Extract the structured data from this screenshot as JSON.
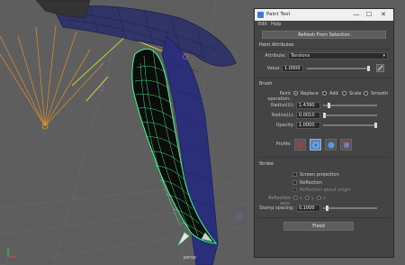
{
  "window": {
    "title": "Paint Tool",
    "controls": {
      "minimize": "—",
      "maximize": "☐",
      "close": "✕"
    }
  },
  "menu": {
    "items": [
      "Edit",
      "Help"
    ]
  },
  "toolbar": {
    "refresh_label": "Refresh From Selection"
  },
  "paint_attributes": {
    "heading": "Paint Attributes",
    "attribute_label": "Attribute:",
    "attribute_value": "Tensions",
    "value_label": "Value:",
    "value": "1.0000",
    "value_slider_fraction": 1.0
  },
  "brush": {
    "heading": "Brush",
    "paint_operation_label": "Paint operation:",
    "operations": [
      "Replace",
      "Add",
      "Scale",
      "Smooth"
    ],
    "selected_operation": "Replace",
    "radius_u_label": "Radius(U):",
    "radius_u": "1.4390",
    "radius_u_fraction": 0.08,
    "radius_l_label": "Radius(L):",
    "radius_l": "0.0010",
    "radius_l_fraction": 0.0,
    "opacity_label": "Opacity:",
    "opacity": "1.0000",
    "opacity_fraction": 1.0,
    "profile_label": "Profile:",
    "profiles": [
      "gaussian-icon",
      "soft-icon",
      "solid-icon",
      "square-icon"
    ],
    "selected_profile": "soft-icon"
  },
  "stroke": {
    "heading": "Stroke",
    "screen_projection": "Screen projection",
    "reflection": "Reflection",
    "reflection_about_origin": "Reflection about origin",
    "reflection_axis_label": "Reflection axis:",
    "axes": [
      "x",
      "y",
      "z"
    ],
    "stamp_spacing_label": "Stamp spacing:",
    "stamp_spacing": "0.1000",
    "stamp_spacing_fraction": 0.05
  },
  "actions": {
    "flood_label": "Flood"
  },
  "viewport": {
    "camera_label": "persp"
  },
  "colors": {
    "wire_highlight": "#3dff8c",
    "wire_default": "#2b2f7a",
    "joint_orange": "#d4892b",
    "selected_blue": "#5f86b4"
  }
}
